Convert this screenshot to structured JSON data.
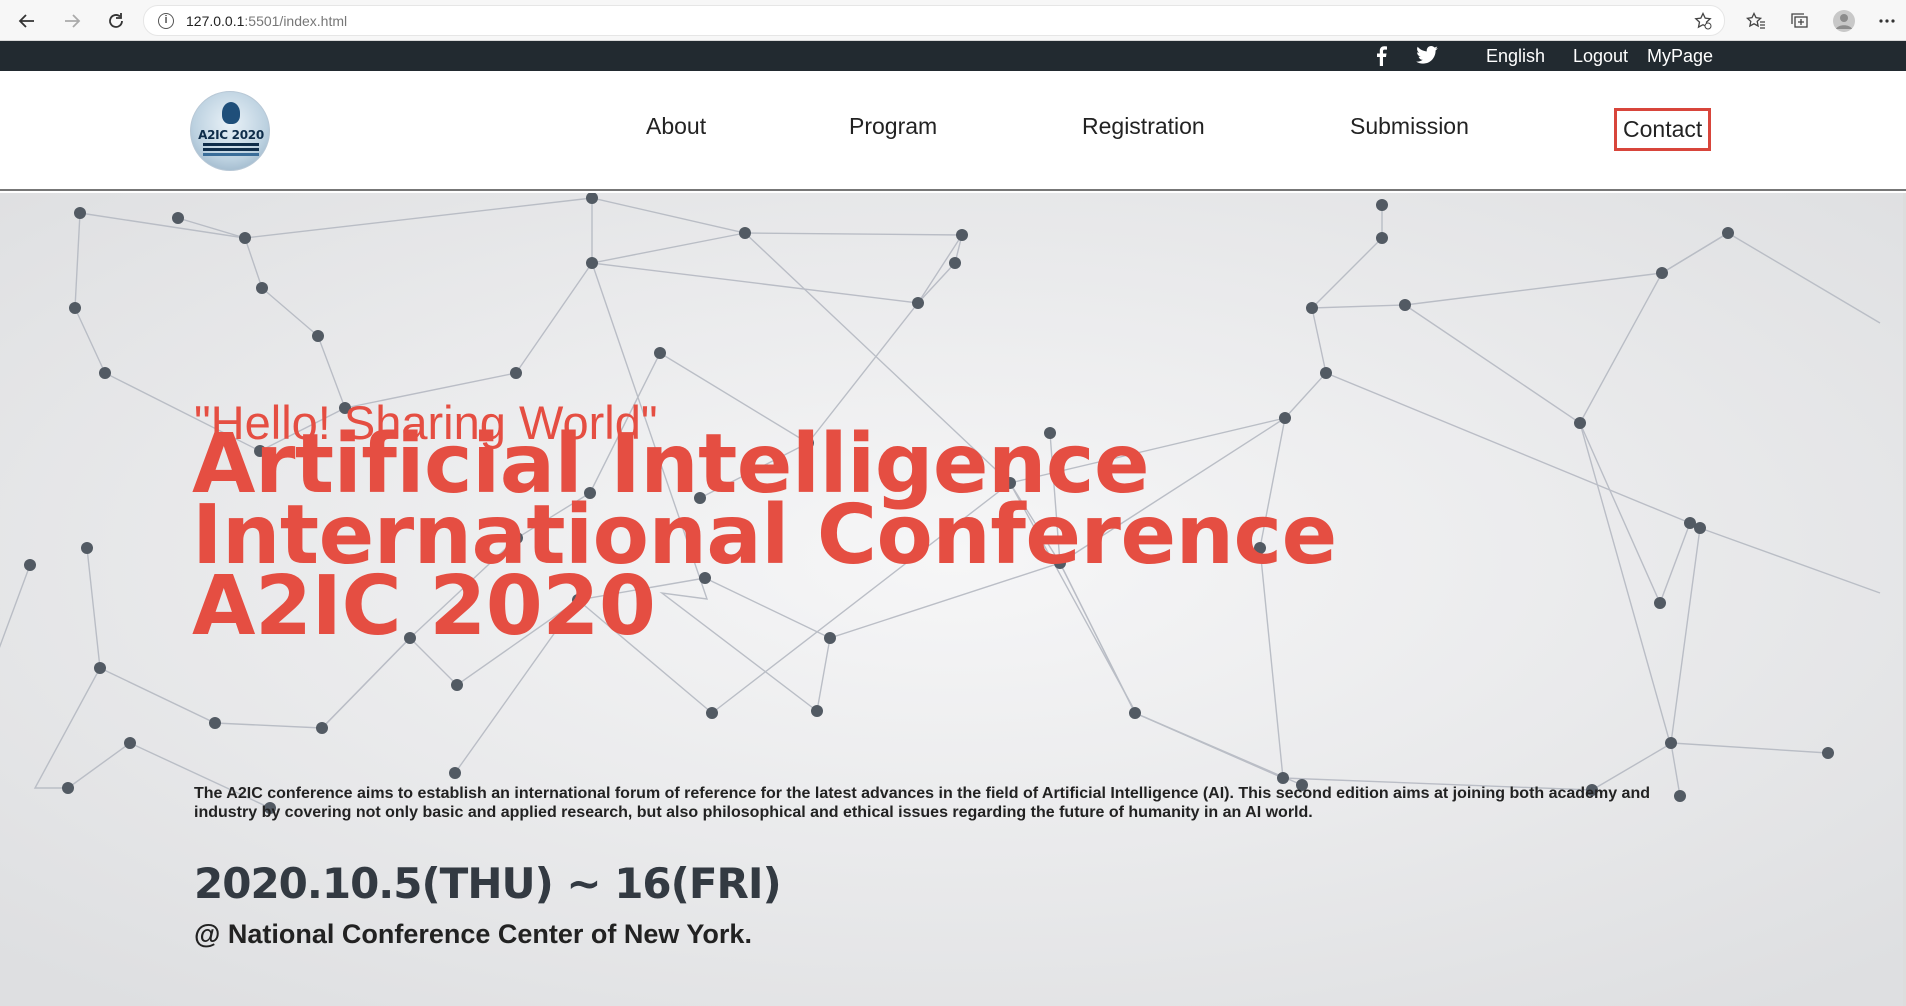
{
  "browser": {
    "url_host": "127.0.0.1",
    "url_rest": ":5501/index.html",
    "icons": [
      "back-icon",
      "forward-icon",
      "reload-icon",
      "info-icon",
      "favorite-add-icon",
      "favorites-icon",
      "collections-icon",
      "profile-icon",
      "more-icon"
    ]
  },
  "top_bar": {
    "language": "English",
    "logout": "Logout",
    "mypage": "MyPage",
    "icons": [
      "facebook-icon",
      "twitter-icon"
    ]
  },
  "header": {
    "logo_text": "A2IC 2020",
    "nav": [
      "About",
      "Program",
      "Registration",
      "Submission",
      "Contact"
    ],
    "active_nav": "Contact"
  },
  "hero": {
    "slogan": "\"Hello! Sharing World\"",
    "title_lines": [
      "Artificial Intelligence",
      "International Conference",
      "A2IC 2020"
    ],
    "description": "The A2IC conference aims to establish an international forum of reference for the latest advances in the field of Artificial Intelligence (AI). This second edition aims at joining both academy and industry by covering not only basic and applied research, but also philosophical and ethical issues regarding the future of humanity in an AI world.",
    "date": "2020.10.5(THU) ~ 16(FRI)",
    "venue": "@ National Conference Center of New York."
  },
  "colors": {
    "accent": "#e54e42",
    "top_bar_bg": "#222a30",
    "date_text": "#333a42"
  }
}
